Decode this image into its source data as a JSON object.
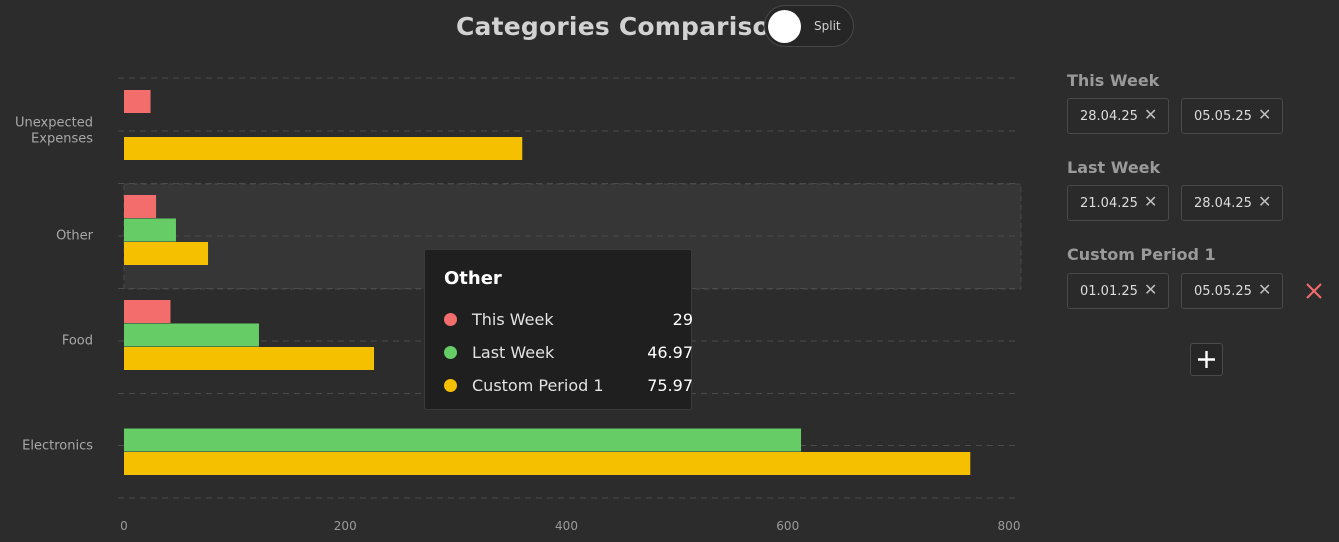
{
  "header": {
    "title": "Categories Comparison",
    "toggle_label": "Split"
  },
  "chart_data": {
    "type": "bar",
    "orientation": "horizontal",
    "categories": [
      "Unexpected Expenses",
      "Other",
      "Food",
      "Electronics"
    ],
    "category_lines": [
      [
        "Unexpected",
        "Expenses"
      ],
      [
        "Other"
      ],
      [
        "Food"
      ],
      [
        "Electronics"
      ]
    ],
    "series": [
      {
        "name": "This Week",
        "color": "#f46d6d",
        "values": [
          24,
          29,
          42,
          0
        ]
      },
      {
        "name": "Last Week",
        "color": "#66cc66",
        "values": [
          0,
          46.97,
          122,
          612
        ]
      },
      {
        "name": "Custom Period 1",
        "color": "#f5c000",
        "values": [
          360,
          75.97,
          226,
          765
        ]
      }
    ],
    "xlim": [
      0,
      800
    ],
    "xticks": [
      "0",
      "200",
      "400",
      "600",
      "800"
    ],
    "grid": true,
    "highlighted_category": "Other"
  },
  "tooltip": {
    "title": "Other",
    "rows": [
      {
        "name": "This Week",
        "value": "29",
        "color": "#f46d6d"
      },
      {
        "name": "Last Week",
        "value": "46.97",
        "color": "#66cc66"
      },
      {
        "name": "Custom Period 1",
        "value": "75.97",
        "color": "#f5c000"
      }
    ]
  },
  "periods": [
    {
      "title": "This Week",
      "start": "28.04.25",
      "end": "05.05.25",
      "removable": false
    },
    {
      "title": "Last Week",
      "start": "21.04.25",
      "end": "28.04.25",
      "removable": false
    },
    {
      "title": "Custom Period 1",
      "start": "01.01.25",
      "end": "05.05.25",
      "removable": true
    }
  ],
  "icons": {
    "clear": "close-icon",
    "remove": "remove-period-icon",
    "add": "plus-icon"
  },
  "colors": {
    "background": "#2c2c2c",
    "remove_accent": "#f46d6d"
  }
}
